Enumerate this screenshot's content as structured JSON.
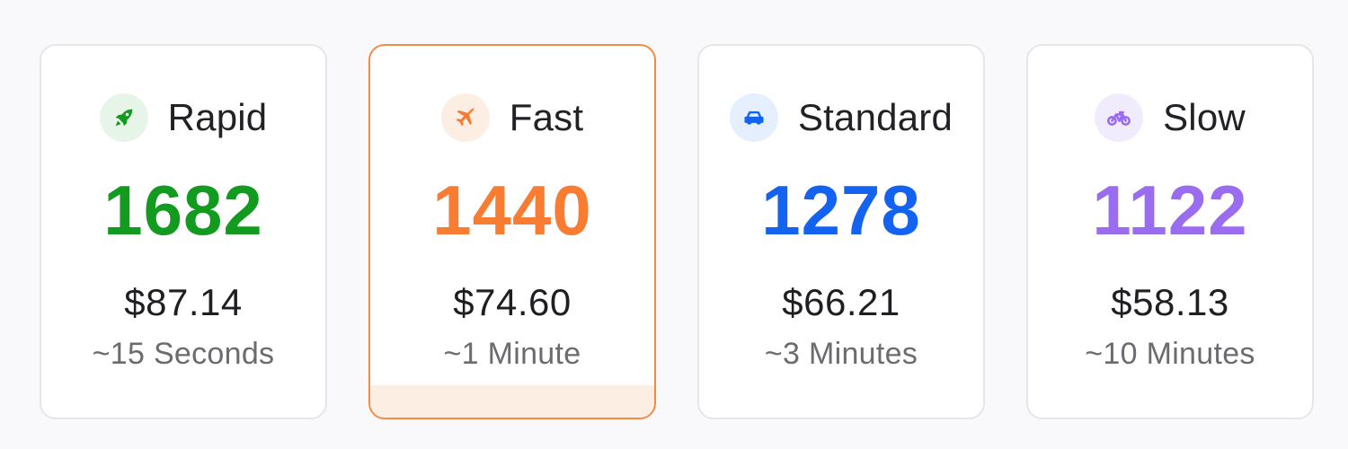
{
  "tiers": [
    {
      "label": "Rapid",
      "count": "1682",
      "price": "$87.14",
      "eta": "~15 Seconds",
      "icon": "rocket-icon",
      "color": "#139b20",
      "icon_bg": "#e7f5e8",
      "selected": false
    },
    {
      "label": "Fast",
      "count": "1440",
      "price": "$74.60",
      "eta": "~1 Minute",
      "icon": "airplane-icon",
      "color": "#f87d32",
      "icon_bg": "#fdeee4",
      "selected": true
    },
    {
      "label": "Standard",
      "count": "1278",
      "price": "$66.21",
      "eta": "~3 Minutes",
      "icon": "car-icon",
      "color": "#1463f0",
      "icon_bg": "#e6effd",
      "selected": false
    },
    {
      "label": "Slow",
      "count": "1122",
      "price": "$58.13",
      "eta": "~10 Minutes",
      "icon": "bicycle-icon",
      "color": "#9a6cf0",
      "icon_bg": "#f1ecfd",
      "selected": false
    }
  ]
}
